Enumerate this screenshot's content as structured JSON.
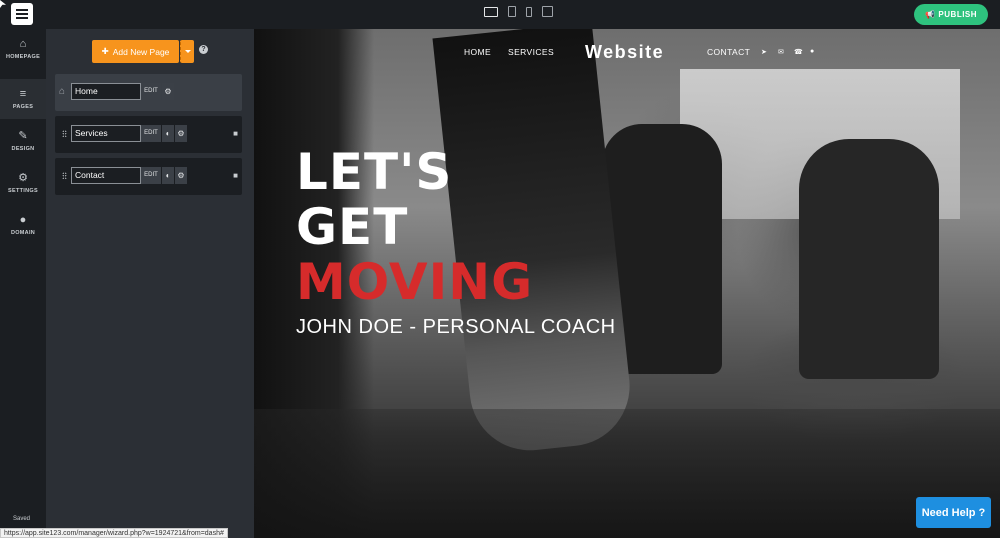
{
  "topbar": {
    "publish_label": "PUBLISH",
    "device_icons": [
      "desktop-icon",
      "tablet-icon",
      "mobile-icon",
      "external-link-icon"
    ]
  },
  "leftnav": {
    "items": [
      {
        "label": "HOMEPAGE",
        "icon": "home-icon"
      },
      {
        "label": "PAGES",
        "icon": "pages-icon"
      },
      {
        "label": "DESIGN",
        "icon": "brush-icon"
      },
      {
        "label": "SETTINGS",
        "icon": "gear-icon"
      },
      {
        "label": "DOMAIN",
        "icon": "globe-icon"
      }
    ],
    "status": "Saved"
  },
  "pages_panel": {
    "add_page_label": "Add New Page",
    "pages": [
      {
        "name": "Home",
        "edit_label": "EDIT"
      },
      {
        "name": "Services",
        "edit_label": "EDIT"
      },
      {
        "name": "Contact",
        "edit_label": "EDIT"
      }
    ]
  },
  "preview": {
    "nav_left": [
      "HOME",
      "SERVICES"
    ],
    "logo": "Website",
    "nav_right": [
      "CONTACT"
    ],
    "hero": {
      "line1": "LET'S",
      "line2": "GET",
      "line3": "MOVING",
      "subtitle": "JOHN DOE - PERSONAL COACH"
    },
    "accent_color": "#d62b2b"
  },
  "help_button": "Need Help ?",
  "status_url": "https://app.site123.com/manager/wizard.php?w=1924721&from=dash#",
  "colors": {
    "publish": "#2ec27e",
    "add_page": "#f7941d",
    "need_help": "#1e8fe0"
  }
}
